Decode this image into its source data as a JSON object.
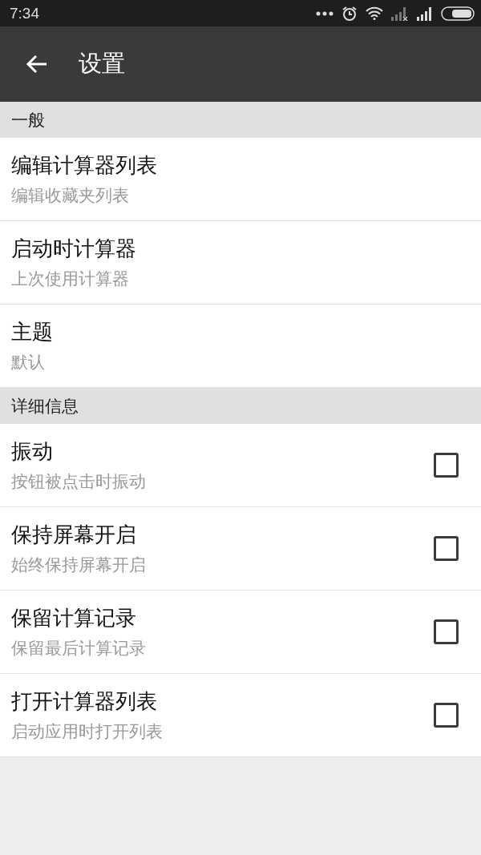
{
  "status_bar": {
    "time": "7:34"
  },
  "app_bar": {
    "title": "设置"
  },
  "sections": [
    {
      "title": "一般",
      "items": [
        {
          "kind": "plain",
          "title": "编辑计算器列表",
          "subtitle": "编辑收藏夹列表"
        },
        {
          "kind": "plain",
          "title": "启动时计算器",
          "subtitle": "上次使用计算器"
        },
        {
          "kind": "plain",
          "title": "主题",
          "subtitle": "默认"
        }
      ]
    },
    {
      "title": "详细信息",
      "items": [
        {
          "kind": "checkbox",
          "title": "振动",
          "subtitle": "按钮被点击时振动",
          "checked": false
        },
        {
          "kind": "checkbox",
          "title": "保持屏幕开启",
          "subtitle": "始终保持屏幕开启",
          "checked": false
        },
        {
          "kind": "checkbox",
          "title": "保留计算记录",
          "subtitle": "保留最后计算记录",
          "checked": false
        },
        {
          "kind": "checkbox",
          "title": "打开计算器列表",
          "subtitle": "启动应用时打开列表",
          "checked": false
        }
      ]
    }
  ]
}
